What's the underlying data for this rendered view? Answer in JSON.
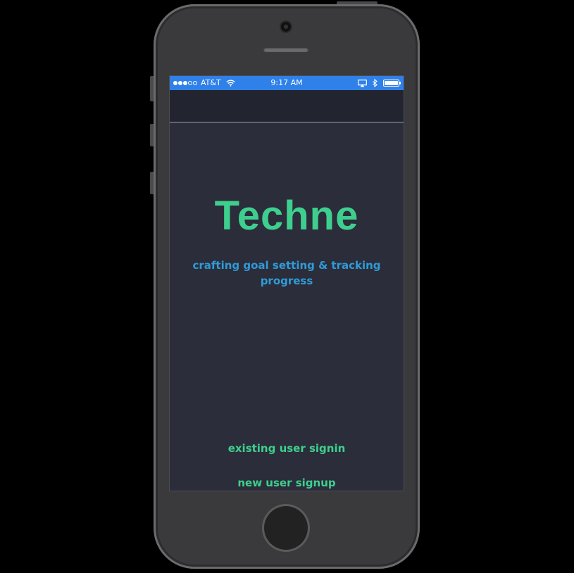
{
  "status_bar": {
    "carrier": "AT&T",
    "time": "9:17 AM",
    "signal_bars_filled": 3,
    "signal_bars_total": 5,
    "icons": [
      "wifi-icon",
      "airplay-icon",
      "bluetooth-icon",
      "battery-icon"
    ]
  },
  "main": {
    "app_name": "Techne",
    "tagline": "crafting goal setting & tracking progress",
    "signin_label": "existing user signin",
    "signup_label": "new user signup"
  },
  "colors": {
    "status_bar": "#2f80e8",
    "background": "#2b2d3a",
    "nav_bar": "#222530",
    "accent_green": "#3ecf8e",
    "tagline_blue": "#2f9bd8"
  }
}
